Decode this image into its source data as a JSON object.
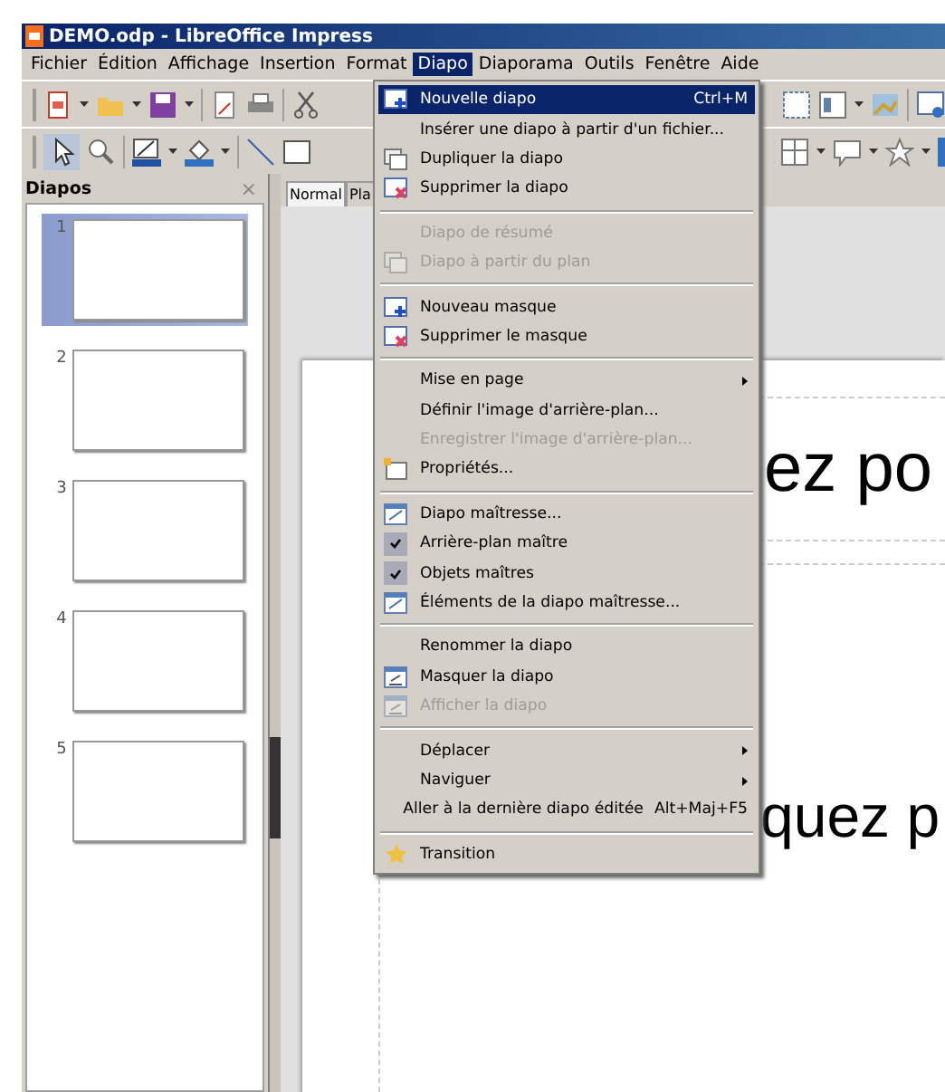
{
  "window": {
    "title": "DEMO.odp - LibreOffice Impress"
  },
  "menubar": [
    {
      "label": "Fichier",
      "selected": false
    },
    {
      "label": "Édition",
      "selected": false
    },
    {
      "label": "Affichage",
      "selected": false
    },
    {
      "label": "Insertion",
      "selected": false
    },
    {
      "label": "Format",
      "selected": false
    },
    {
      "label": "Diapo",
      "selected": true
    },
    {
      "label": "Diaporama",
      "selected": false
    },
    {
      "label": "Outils",
      "selected": false
    },
    {
      "label": "Fenêtre",
      "selected": false
    },
    {
      "label": "Aide",
      "selected": false
    }
  ],
  "menu": [
    {
      "kind": "item",
      "label": "Nouvelle diapo",
      "shortcut": "Ctrl+M",
      "selected": true,
      "disabled": false
    },
    {
      "kind": "item",
      "label": "Insérer une diapo à partir d'un fichier...",
      "selected": false,
      "disabled": false
    },
    {
      "kind": "item",
      "label": "Dupliquer la diapo",
      "selected": false,
      "disabled": false
    },
    {
      "kind": "item",
      "label": "Supprimer la diapo",
      "selected": false,
      "disabled": false
    },
    {
      "kind": "separator"
    },
    {
      "kind": "item",
      "label": "Diapo de résumé",
      "selected": false,
      "disabled": true
    },
    {
      "kind": "item",
      "label": "Diapo à partir du plan",
      "selected": false,
      "disabled": true
    },
    {
      "kind": "separator"
    },
    {
      "kind": "item",
      "label": "Nouveau masque",
      "selected": false,
      "disabled": false
    },
    {
      "kind": "item",
      "label": "Supprimer le masque",
      "selected": false,
      "disabled": false
    },
    {
      "kind": "separator"
    },
    {
      "kind": "submenu",
      "label": "Mise en page",
      "selected": false,
      "disabled": false
    },
    {
      "kind": "item",
      "label": "Définir l'image d'arrière-plan...",
      "selected": false,
      "disabled": false
    },
    {
      "kind": "item",
      "label": "Enregistrer l'image d'arrière-plan...",
      "selected": false,
      "disabled": true
    },
    {
      "kind": "item",
      "label": "Propriétés...",
      "selected": false,
      "disabled": false
    },
    {
      "kind": "separator"
    },
    {
      "kind": "item",
      "label": "Diapo maîtresse...",
      "selected": false,
      "disabled": false
    },
    {
      "kind": "check",
      "label": "Arrière-plan maître",
      "checked": true,
      "selected": false,
      "disabled": false
    },
    {
      "kind": "check",
      "label": "Objets maîtres",
      "checked": true,
      "selected": false,
      "disabled": false
    },
    {
      "kind": "item",
      "label": "Éléments de la diapo maîtresse...",
      "selected": false,
      "disabled": false
    },
    {
      "kind": "separator"
    },
    {
      "kind": "item",
      "label": "Renommer la diapo",
      "selected": false,
      "disabled": false
    },
    {
      "kind": "item",
      "label": "Masquer la diapo",
      "selected": false,
      "disabled": false
    },
    {
      "kind": "item",
      "label": "Afficher la diapo",
      "selected": false,
      "disabled": true
    },
    {
      "kind": "separator"
    },
    {
      "kind": "submenu",
      "label": "Déplacer",
      "selected": false,
      "disabled": false
    },
    {
      "kind": "submenu",
      "label": "Naviguer",
      "selected": false,
      "disabled": false
    },
    {
      "kind": "item",
      "label": "Aller à la dernière diapo éditée",
      "shortcut": "Alt+Maj+F5",
      "selected": false,
      "disabled": false
    },
    {
      "kind": "separator"
    },
    {
      "kind": "item",
      "label": "Transition",
      "selected": false,
      "disabled": false
    }
  ],
  "slides_panel": {
    "title": "Diapos",
    "close": "×",
    "slides": [
      {
        "number": "1",
        "selected": true
      },
      {
        "number": "2",
        "selected": false
      },
      {
        "number": "3",
        "selected": false
      },
      {
        "number": "4",
        "selected": false
      },
      {
        "number": "5",
        "selected": false
      }
    ]
  },
  "view_tabs": [
    {
      "label": "Normal",
      "selected": true
    },
    {
      "label": "Pla",
      "selected": false
    }
  ],
  "slide": {
    "title_text": "ez po",
    "content_text": "quez p"
  }
}
